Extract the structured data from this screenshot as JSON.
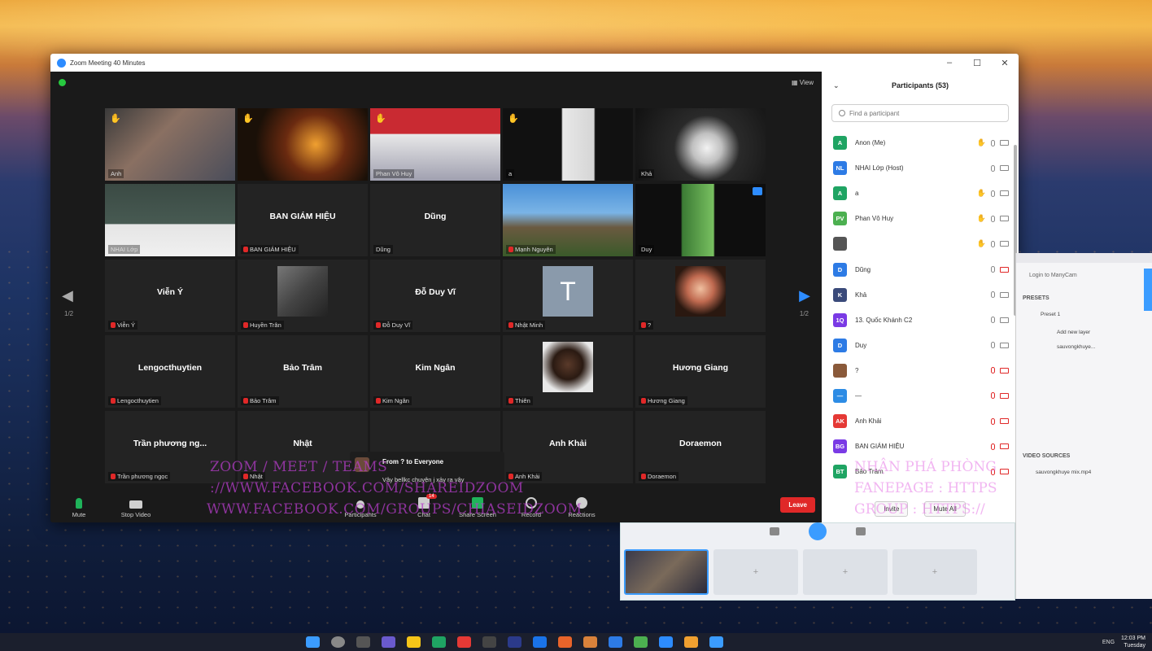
{
  "window": {
    "title": "Zoom Meeting 40 Minutes",
    "minimize": "–",
    "maximize": "☐",
    "close": "✕"
  },
  "meeting": {
    "view_label": "View"
  },
  "tiles": [
    {
      "id": "t1",
      "name": "Anh",
      "video": "v1",
      "hand": true,
      "muted": false
    },
    {
      "id": "t2",
      "name": "",
      "video": "v2",
      "hand": true,
      "muted": false
    },
    {
      "id": "t3",
      "name": "Phan Vô Huy",
      "video": "v3",
      "hand": true,
      "muted": false
    },
    {
      "id": "t4",
      "name": "a",
      "video": "v4",
      "hand": true,
      "muted": false,
      "active": true
    },
    {
      "id": "t5",
      "name": "Khả",
      "video": "v5",
      "hand": false,
      "muted": false
    },
    {
      "id": "t6",
      "name": "NHAI Lớp",
      "video": "v6",
      "hand": false,
      "muted": false
    },
    {
      "id": "t7",
      "name": "BAN GIÁM HIỆU",
      "center": "BAN GIÁM HIỆU",
      "muted": true
    },
    {
      "id": "t8",
      "name": "Dũng",
      "center": "Dũng",
      "muted": false
    },
    {
      "id": "t9",
      "name": "Mạnh Nguyên",
      "video": "v7",
      "muted": true
    },
    {
      "id": "t10",
      "name": "Duy",
      "video": "v8",
      "muted": false,
      "badge": true
    },
    {
      "id": "t11",
      "name": "Viễn Ý",
      "center": "Viễn Ý",
      "muted": true
    },
    {
      "id": "t12",
      "name": "Huyền Trân",
      "thumb": "t-gray",
      "muted": true
    },
    {
      "id": "t13",
      "name": "Đỗ Duy Vĩ",
      "center": "Đỗ Duy Vĩ",
      "muted": true
    },
    {
      "id": "t14",
      "name": "Nhật Minh",
      "thumb": "t-letter",
      "letter": "T",
      "muted": true
    },
    {
      "id": "t15",
      "name": "?",
      "thumb": "t-kid",
      "muted": true
    },
    {
      "id": "t16",
      "name": "Lengocthuytien",
      "center": "Lengocthuytien",
      "muted": true
    },
    {
      "id": "t17",
      "name": "Bảo Trâm",
      "center": "Bảo Trâm",
      "muted": true
    },
    {
      "id": "t18",
      "name": "Kim Ngân",
      "center": "Kim Ngân",
      "muted": true
    },
    {
      "id": "t19",
      "name": "Thiên",
      "thumb": "t-man",
      "muted": true
    },
    {
      "id": "t20",
      "name": "Hương Giang",
      "center": "Hương Giang",
      "muted": true
    },
    {
      "id": "t21",
      "name": "Trần phương ngọc",
      "center": "Trần phương ng...",
      "muted": true
    },
    {
      "id": "t22",
      "name": "Nhật",
      "center": "Nhật",
      "muted": true
    },
    {
      "id": "t23",
      "name": "",
      "center": "",
      "muted": false
    },
    {
      "id": "t24",
      "name": "Anh Khải",
      "center": "Anh Khải",
      "muted": true
    },
    {
      "id": "t25",
      "name": "Doraemon",
      "center": "Doraemon",
      "muted": true
    }
  ],
  "pagination": {
    "left": "1/2",
    "right": "1/2"
  },
  "chat_preview": {
    "from": "From ? to Everyone",
    "message": "Vậy bellkc chuyện j xảy ra vậy"
  },
  "toolbar": {
    "mute": "Mute",
    "stop_video": "Stop Video",
    "participants": "Participants",
    "participants_count": "53",
    "chat": "Chat",
    "chat_badge": "14",
    "share": "Share Screen",
    "record": "Record",
    "reactions": "Reactions",
    "leave": "Leave"
  },
  "participants_panel": {
    "title": "Participants (53)",
    "search_placeholder": "Find a participant",
    "invite": "Invite",
    "mute_all": "Mute All",
    "items": [
      {
        "initials": "A",
        "name": "Anon (Me)",
        "color": "#1fa463",
        "hand": true,
        "mic_off": false,
        "cam_off": false
      },
      {
        "initials": "NL",
        "name": "NHAI Lớp (Host)",
        "color": "#2d7be5",
        "hand": false,
        "mic_off": false,
        "cam_off": false
      },
      {
        "initials": "A",
        "name": "a",
        "color": "#1fa463",
        "hand": true,
        "mic_off": false,
        "cam_off": false
      },
      {
        "initials": "PV",
        "name": "Phan Vô Huy",
        "color": "#4cb050",
        "hand": true,
        "mic_off": false,
        "cam_off": false
      },
      {
        "initials": "",
        "name": "",
        "color": "#555555",
        "hand": true,
        "mic_off": false,
        "cam_off": false
      },
      {
        "initials": "D",
        "name": "Dũng",
        "color": "#2d7be5",
        "hand": false,
        "mic_off": false,
        "cam_off": true
      },
      {
        "initials": "K",
        "name": "Khả",
        "color": "#3a4a7a",
        "hand": false,
        "mic_off": false,
        "cam_off": false
      },
      {
        "initials": "1Q",
        "name": "13. Quốc Khánh C2",
        "color": "#7a3ae5",
        "hand": false,
        "mic_off": false,
        "cam_off": false
      },
      {
        "initials": "D",
        "name": "Duy",
        "color": "#2d7be5",
        "hand": false,
        "mic_off": false,
        "cam_off": false
      },
      {
        "initials": "",
        "name": "?",
        "color": "#8a5a3a",
        "hand": false,
        "mic_off": true,
        "cam_off": true
      },
      {
        "initials": "—",
        "name": "—",
        "color": "#2d8ce5",
        "hand": false,
        "mic_off": true,
        "cam_off": true
      },
      {
        "initials": "AK",
        "name": "Anh Khải",
        "color": "#e53935",
        "hand": false,
        "mic_off": true,
        "cam_off": true
      },
      {
        "initials": "BG",
        "name": "BAN GIÁM HIỆU",
        "color": "#7a3ae5",
        "hand": false,
        "mic_off": true,
        "cam_off": true
      },
      {
        "initials": "BT",
        "name": "Bảo Trâm",
        "color": "#1fa463",
        "hand": false,
        "mic_off": true,
        "cam_off": true
      }
    ]
  },
  "watermark": {
    "line1": "ZOOM / MEET / TEAMS",
    "line2": "://WWW.FACEBOOK.COM/SHAREIDZOOM",
    "line3": "WWW.FACEBOOK.COM/GROUPS/CHIASEIDZOOM",
    "right1": "NHẬN PHÁ PHÒNG",
    "right2": "FANEPAGE : HTTPS",
    "right3": "GROUP : HTTPS://"
  },
  "side_app": {
    "login": "Login to ManyCam",
    "presets": "PRESETS",
    "preset1": "Preset 1",
    "add_layer": "Add new layer",
    "layer_file": "sauvongkhuye...",
    "video_sources": "VIDEO SOURCES",
    "source_file": "sauvongkhuye mix.mp4"
  },
  "taskbar": {
    "lang": "ENG",
    "time": "12:03 PM",
    "day": "Tuesday"
  }
}
